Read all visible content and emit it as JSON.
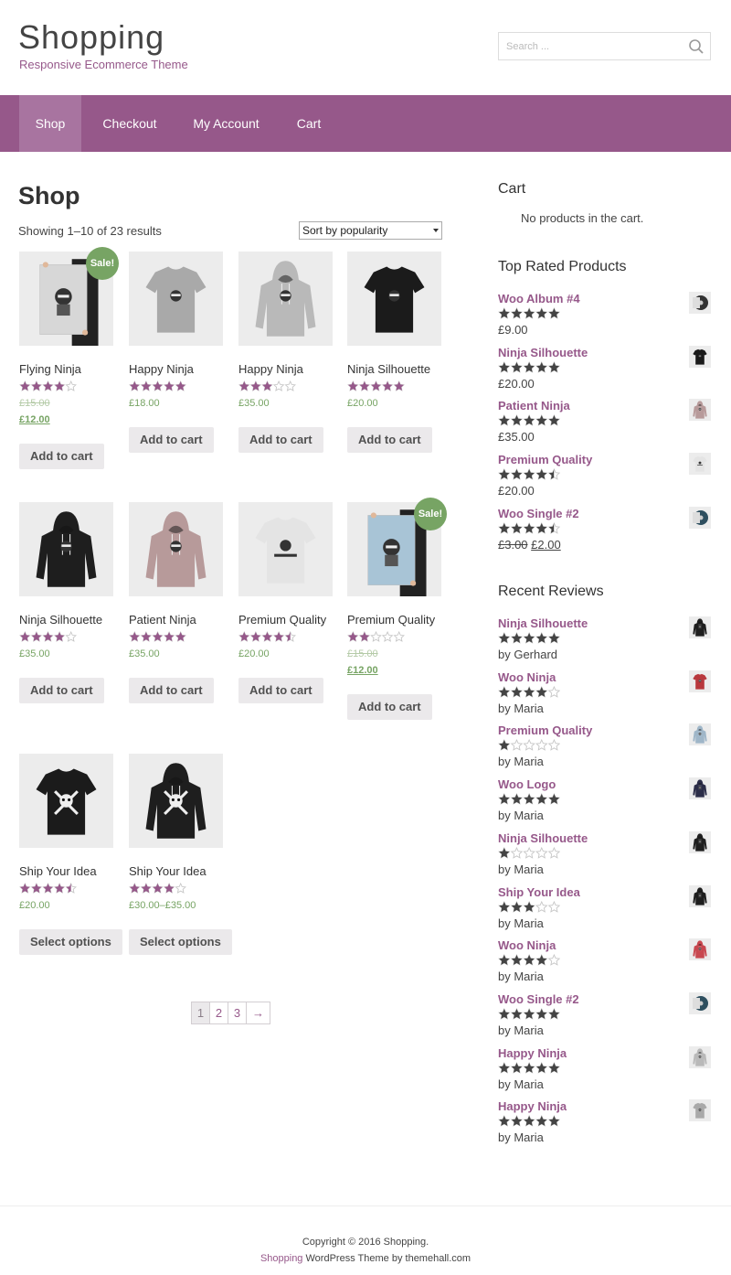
{
  "site": {
    "title": "Shopping",
    "tagline": "Responsive Ecommerce Theme"
  },
  "search": {
    "placeholder": "Search ..."
  },
  "nav": {
    "items": [
      {
        "label": "Shop"
      },
      {
        "label": "Checkout"
      },
      {
        "label": "My Account"
      },
      {
        "label": "Cart"
      }
    ]
  },
  "shop": {
    "title": "Shop",
    "result_count": "Showing 1–10 of 23 results",
    "sort_label": "Sort by popularity"
  },
  "products": [
    {
      "name": "Flying Ninja",
      "rating": 4,
      "old_price": "£15.00",
      "price": "£12.00",
      "sale": "Sale!",
      "button": "Add to cart",
      "item": "poster-ninja"
    },
    {
      "name": "Happy Ninja",
      "rating": 5,
      "price": "£18.00",
      "button": "Add to cart",
      "item": "tshirt-grey"
    },
    {
      "name": "Happy Ninja",
      "rating": 3,
      "price": "£35.00",
      "button": "Add to cart",
      "item": "hoodie-grey"
    },
    {
      "name": "Ninja Silhouette",
      "rating": 5,
      "price": "£20.00",
      "button": "Add to cart",
      "item": "tshirt-black"
    },
    {
      "name": "Ninja Silhouette",
      "rating": 4,
      "price": "£35.00",
      "button": "Add to cart",
      "item": "hoodie-black"
    },
    {
      "name": "Patient Ninja",
      "rating": 5,
      "price": "£35.00",
      "button": "Add to cart",
      "item": "hoodie-pink"
    },
    {
      "name": "Premium Quality",
      "rating": 4.5,
      "price": "£20.00",
      "button": "Add to cart",
      "item": "tshirt-white"
    },
    {
      "name": "Premium Quality",
      "rating": 2,
      "old_price": "£15.00",
      "price": "£12.00",
      "sale": "Sale!",
      "button": "Add to cart",
      "item": "poster-blue"
    },
    {
      "name": "Ship Your Idea",
      "rating": 4.5,
      "price": "£20.00",
      "button": "Select options",
      "item": "tshirt-black-skull"
    },
    {
      "name": "Ship Your Idea",
      "rating": 4,
      "price": "£30.00–£35.00",
      "button": "Select options",
      "item": "hoodie-black-skull"
    }
  ],
  "pagination": {
    "pages": [
      "1",
      "2",
      "3"
    ],
    "next": "→",
    "current": "1"
  },
  "sidebar": {
    "cart": {
      "title": "Cart",
      "empty": "No products in the cart."
    },
    "top_rated": {
      "title": "Top Rated Products",
      "items": [
        {
          "name": "Woo Album #4",
          "rating": 5,
          "price": "£9.00",
          "thumb": "album"
        },
        {
          "name": "Ninja Silhouette",
          "rating": 5,
          "price": "£20.00",
          "thumb": "tshirt-black"
        },
        {
          "name": "Patient Ninja",
          "rating": 5,
          "price": "£35.00",
          "thumb": "hoodie-pink"
        },
        {
          "name": "Premium Quality",
          "rating": 4.5,
          "price": "£20.00",
          "thumb": "tshirt-white"
        },
        {
          "name": "Woo Single #2",
          "rating": 4.5,
          "old_price": "£3.00",
          "price": "£2.00",
          "thumb": "album-blue"
        }
      ]
    },
    "recent_reviews": {
      "title": "Recent Reviews",
      "items": [
        {
          "name": "Ninja Silhouette",
          "rating": 5,
          "by": "by Gerhard",
          "thumb": "hoodie-black"
        },
        {
          "name": "Woo Ninja",
          "rating": 4,
          "by": "by Maria",
          "thumb": "tshirt-red"
        },
        {
          "name": "Premium Quality",
          "rating": 1,
          "by": "by Maria",
          "thumb": "hoodie-blue"
        },
        {
          "name": "Woo Logo",
          "rating": 5,
          "by": "by Maria",
          "thumb": "hoodie-navy"
        },
        {
          "name": "Ninja Silhouette",
          "rating": 1,
          "by": "by Maria",
          "thumb": "hoodie-black"
        },
        {
          "name": "Ship Your Idea",
          "rating": 3,
          "by": "by Maria",
          "thumb": "hoodie-black"
        },
        {
          "name": "Woo Ninja",
          "rating": 4,
          "by": "by Maria",
          "thumb": "hoodie-red"
        },
        {
          "name": "Woo Single #2",
          "rating": 5,
          "by": "by Maria",
          "thumb": "album-blue"
        },
        {
          "name": "Happy Ninja",
          "rating": 5,
          "by": "by Maria",
          "thumb": "hoodie-grey"
        },
        {
          "name": "Happy Ninja",
          "rating": 5,
          "by": "by Maria",
          "thumb": "tshirt-grey"
        }
      ]
    }
  },
  "footer": {
    "copyright": "Copyright © 2016 Shopping.",
    "theme_link": "Shopping",
    "credit": " WordPress Theme by themehall.com"
  },
  "colors": {
    "accent": "#96588a",
    "nav_active": "#a874a0",
    "price": "#77a464",
    "sale_badge": "#77a464",
    "star_sidebar": "#444444",
    "star_product": "#96588a"
  }
}
